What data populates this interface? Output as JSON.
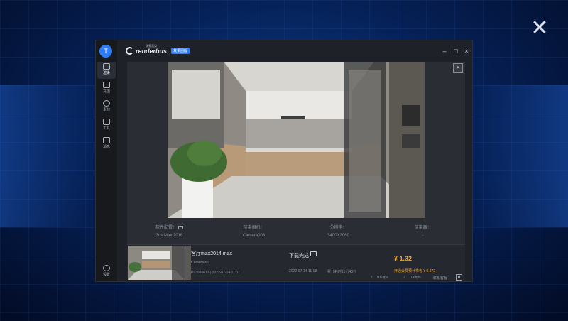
{
  "app": {
    "brand": "renderbus",
    "brand_sub": "瑞云渲染",
    "badge": "效果图版",
    "avatar_letter": "T",
    "accent": "#2e7cf6",
    "price_color": "#f2a52b"
  },
  "window_controls": {
    "minimize": "–",
    "maximize": "□",
    "close": "×"
  },
  "overlay": {
    "close": "✕"
  },
  "sidebar": {
    "items": [
      {
        "label": "渲染",
        "icon": "home-icon"
      },
      {
        "label": "充值",
        "icon": "wallet-icon"
      },
      {
        "label": "素材",
        "icon": "palette-icon"
      },
      {
        "label": "工具",
        "icon": "tools-icon"
      },
      {
        "label": "消息",
        "icon": "message-icon"
      }
    ],
    "settings_label": "设置"
  },
  "preview": {
    "close": "×",
    "info": [
      {
        "key": "软件配置：",
        "value": "3ds Max 2016"
      },
      {
        "key": "渲染相机：",
        "value": "Camera003"
      },
      {
        "key": "分辨率：",
        "value": "3400X2060"
      },
      {
        "key": "渲染器：",
        "value": "-"
      }
    ]
  },
  "task": {
    "filename": "客厅max2014.max",
    "camera": "Camera003",
    "meta": "P93936617  |  2022-07-14 11:01",
    "status": "下载完成",
    "done_time": "2022-07-14 11:18",
    "duration": "累计耗时15分43秒",
    "price": "¥ 1.32",
    "vip": "开通会员预计节省 ¥ 0.272"
  },
  "statusbar": {
    "upload": "0 Kbps",
    "download": "0 Kbps",
    "contact": "联系客服"
  }
}
